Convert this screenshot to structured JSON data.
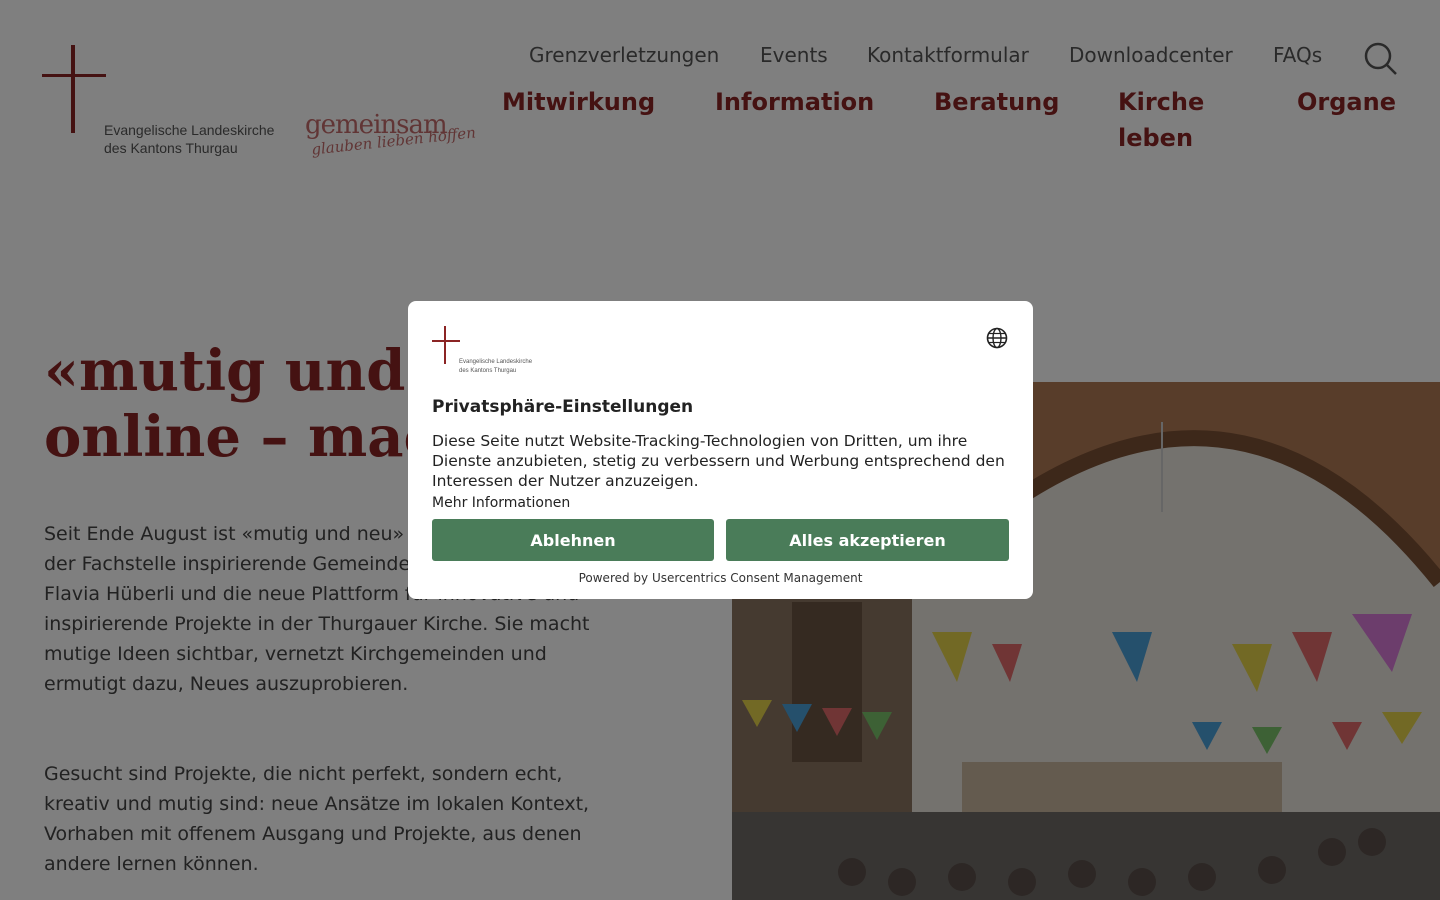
{
  "header": {
    "logo_text_line1": "Evangelische Landeskirche",
    "logo_text_line2": "des Kantons Thurgau",
    "slogan_main": "gemeinsam",
    "slogan_sub": "glauben lieben hoffen",
    "top_nav": [
      "Grenzverletzungen",
      "Events",
      "Kontaktformular",
      "Downloadcenter",
      "FAQs"
    ],
    "main_nav": [
      "Mitwirkung",
      "Information",
      "Beratung",
      "Kirche leben",
      "Organe"
    ]
  },
  "hero": {
    "title_line1": "«mutig und neu»",
    "title_line2": "online – mach mit!",
    "paragraph1": "Seit Ende August ist «mutig und neu» online. Die Initiative der Fachstelle inspirierende Gemeindeentwicklung von Flavia Hüberli und die neue Plattform für innovative und inspirierende Projekte in der Thurgauer Kirche. Sie macht mutige Ideen sichtbar, vernetzt Kirchgemeinden und ermutigt dazu, Neues auszuprobieren.",
    "paragraph2": "Gesucht sind Projekte, die nicht perfekt, sondern echt, kreativ und mutig sind: neue Ansätze im lokalen Kontext, Vorhaben mit offenem Ausgang und Projekte, aus denen andere lernen können."
  },
  "consent": {
    "logo_line1": "Evangelische Landeskirche",
    "logo_line2": "des Kantons Thurgau",
    "title": "Privatsphäre-Einstellungen",
    "text": "Diese Seite nutzt Website-Tracking-Technologien von Dritten, um ihre Dienste anzubieten, stetig zu verbessern und Werbung entsprechend den Interessen der Nutzer anzuzeigen.",
    "more_info": "Mehr Informationen",
    "deny_label": "Ablehnen",
    "accept_label": "Alles akzeptieren",
    "powered_by": "Powered by Usercentrics Consent Management"
  },
  "colors": {
    "brand_red": "#8b2424",
    "button_green": "#4a7c59"
  }
}
